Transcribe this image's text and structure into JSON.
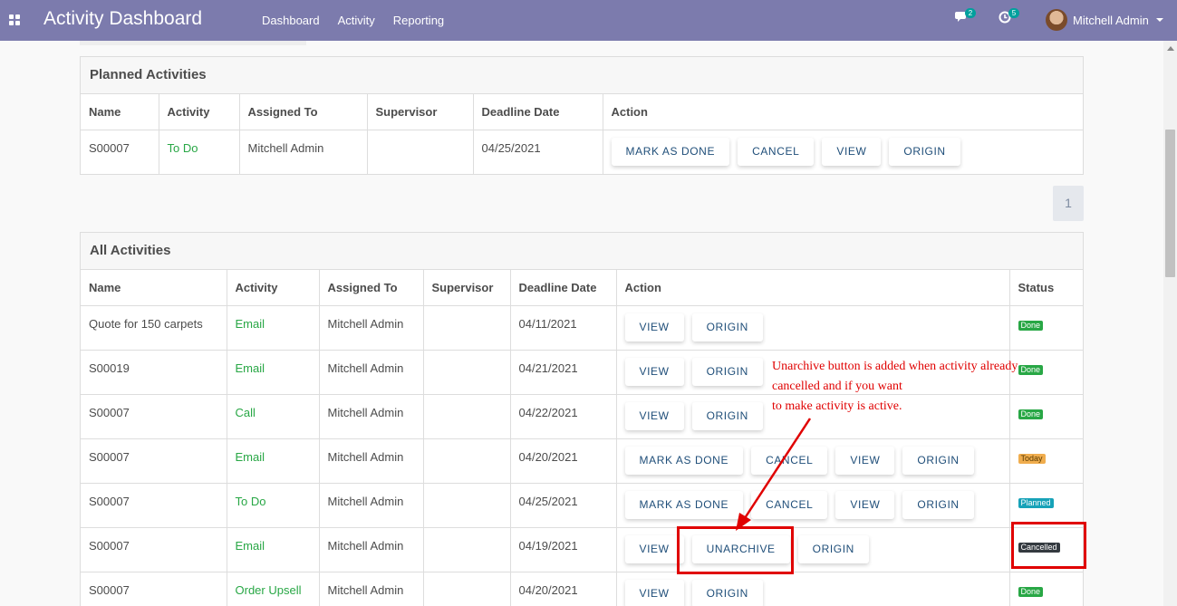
{
  "navbar": {
    "title": "Activity Dashboard",
    "menu": [
      "Dashboard",
      "Activity",
      "Reporting"
    ],
    "messages_count": "2",
    "activities_count": "5",
    "user_name": "Mitchell Admin"
  },
  "planned": {
    "title": "Planned Activities",
    "headers": [
      "Name",
      "Activity",
      "Assigned To",
      "Supervisor",
      "Deadline Date",
      "Action"
    ],
    "rows": [
      {
        "name": "S00007",
        "activity": "To Do",
        "assigned": "Mitchell Admin",
        "supervisor": "",
        "deadline": "04/25/2021",
        "actions": [
          "MARK AS DONE",
          "CANCEL",
          "VIEW",
          "ORIGIN"
        ]
      }
    ]
  },
  "pager": {
    "page": "1"
  },
  "all": {
    "title": "All Activities",
    "headers": [
      "Name",
      "Activity",
      "Assigned To",
      "Supervisor",
      "Deadline Date",
      "Action",
      "Status"
    ],
    "rows": [
      {
        "name": "Quote for 150 carpets",
        "activity": "Email",
        "assigned": "Mitchell Admin",
        "supervisor": "",
        "deadline": "04/11/2021",
        "actions": [
          "VIEW",
          "ORIGIN"
        ],
        "status": "Done"
      },
      {
        "name": "S00019",
        "activity": "Email",
        "assigned": "Mitchell Admin",
        "supervisor": "",
        "deadline": "04/21/2021",
        "actions": [
          "VIEW",
          "ORIGIN"
        ],
        "status": "Done"
      },
      {
        "name": "S00007",
        "activity": "Call",
        "assigned": "Mitchell Admin",
        "supervisor": "",
        "deadline": "04/22/2021",
        "actions": [
          "VIEW",
          "ORIGIN"
        ],
        "status": "Done"
      },
      {
        "name": "S00007",
        "activity": "Email",
        "assigned": "Mitchell Admin",
        "supervisor": "",
        "deadline": "04/20/2021",
        "actions": [
          "MARK AS DONE",
          "CANCEL",
          "VIEW",
          "ORIGIN"
        ],
        "status": "Today"
      },
      {
        "name": "S00007",
        "activity": "To Do",
        "assigned": "Mitchell Admin",
        "supervisor": "",
        "deadline": "04/25/2021",
        "actions": [
          "MARK AS DONE",
          "CANCEL",
          "VIEW",
          "ORIGIN"
        ],
        "status": "Planned"
      },
      {
        "name": "S00007",
        "activity": "Email",
        "assigned": "Mitchell Admin",
        "supervisor": "",
        "deadline": "04/19/2021",
        "actions": [
          "VIEW",
          "UNARCHIVE",
          "ORIGIN"
        ],
        "status": "Cancelled"
      },
      {
        "name": "S00007",
        "activity": "Order Upsell",
        "assigned": "Mitchell Admin",
        "supervisor": "",
        "deadline": "04/20/2021",
        "actions": [
          "VIEW",
          "ORIGIN"
        ],
        "status": "Done"
      }
    ]
  },
  "annotation": {
    "lines": [
      "Unarchive button is added when activity already",
      "cancelled and if you want",
      "to make activity is active."
    ],
    "color": "#e00000"
  },
  "colors": {
    "navbar": "#7c7bad",
    "activity_text": "#28a745",
    "button_text": "#1f4e79"
  }
}
